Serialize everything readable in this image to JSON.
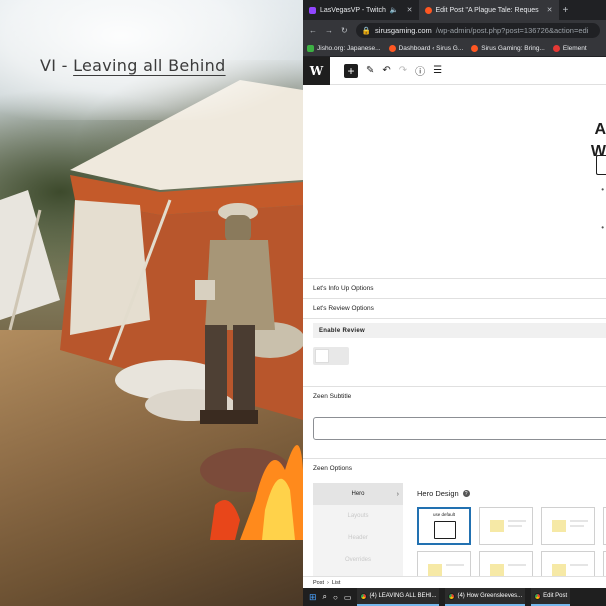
{
  "scene": {
    "title_prefix": "VI - ",
    "title_main": "Leaving all Behind"
  },
  "browser": {
    "tabs": [
      {
        "label": "LasVegasVP - Twitch",
        "active": false,
        "color": "#9146ff"
      },
      {
        "label": "Edit Post \"A Plague Tale: Reques",
        "active": true,
        "color": "#ff5722"
      }
    ],
    "url_host": "sirusgaming.com",
    "url_path": "/wp-admin/post.php?post=136726&action=edi",
    "bookmarks": [
      {
        "label": "Jisho.org: Japanese...",
        "color": "#3cb043"
      },
      {
        "label": "Dashboard ‹ Sirus G...",
        "color": "#ff5722"
      },
      {
        "label": "Sirus Gaming: Bring...",
        "color": "#ff5722"
      },
      {
        "label": "Element",
        "color": "#e53935"
      }
    ]
  },
  "editor": {
    "title_line1": "A",
    "title_line2": "W",
    "dot1": "•",
    "dot2": "•"
  },
  "panels": {
    "info_up": "Let's Info Up Options",
    "review": "Let's Review Options",
    "enable_review": "Enable Review",
    "subtitle": "Zeen Subtitle",
    "zeen_options": "Zeen Options"
  },
  "zeen_nav": {
    "items": [
      "Hero",
      "Layouts",
      "Header",
      "Overrides"
    ],
    "hero_design": "Hero Design",
    "default_caption": "use default"
  },
  "breadcrumb": {
    "items": [
      "Post",
      "List"
    ]
  },
  "taskbar": {
    "apps": [
      "(4) LEAVING ALL BEHI...",
      "(4) How Greensleeves...",
      "Edit Post"
    ]
  },
  "colors": {
    "wp_dark": "#1e1e1e",
    "accent": "#2271b1",
    "browser_dark": "#35363a"
  }
}
